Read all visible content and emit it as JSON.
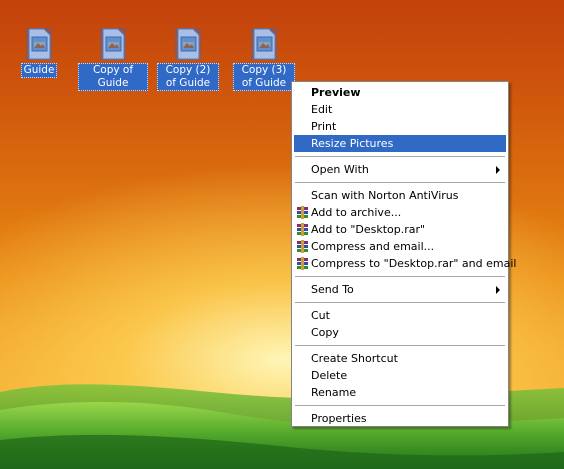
{
  "desktop": {
    "icons": [
      {
        "label": "Guide"
      },
      {
        "label": "Copy of Guide"
      },
      {
        "label": "Copy (2) of Guide"
      },
      {
        "label": "Copy (3) of Guide"
      }
    ]
  },
  "context_menu": {
    "preview": "Preview",
    "edit": "Edit",
    "print": "Print",
    "resize_pictures": "Resize Pictures",
    "open_with": "Open With",
    "scan_norton": "Scan with Norton AntiVirus",
    "add_to_archive": "Add to archive...",
    "add_to_desktop_rar": "Add to \"Desktop.rar\"",
    "compress_and_email": "Compress and email...",
    "compress_to_desktop_rar_email": "Compress to \"Desktop.rar\" and email",
    "send_to": "Send To",
    "cut": "Cut",
    "copy": "Copy",
    "create_shortcut": "Create Shortcut",
    "delete": "Delete",
    "rename": "Rename",
    "properties": "Properties"
  },
  "colors": {
    "selection": "#316ac5",
    "sky_top": "#c2420b",
    "sky_bottom": "#f6b838",
    "grass": "#4fa62a"
  }
}
